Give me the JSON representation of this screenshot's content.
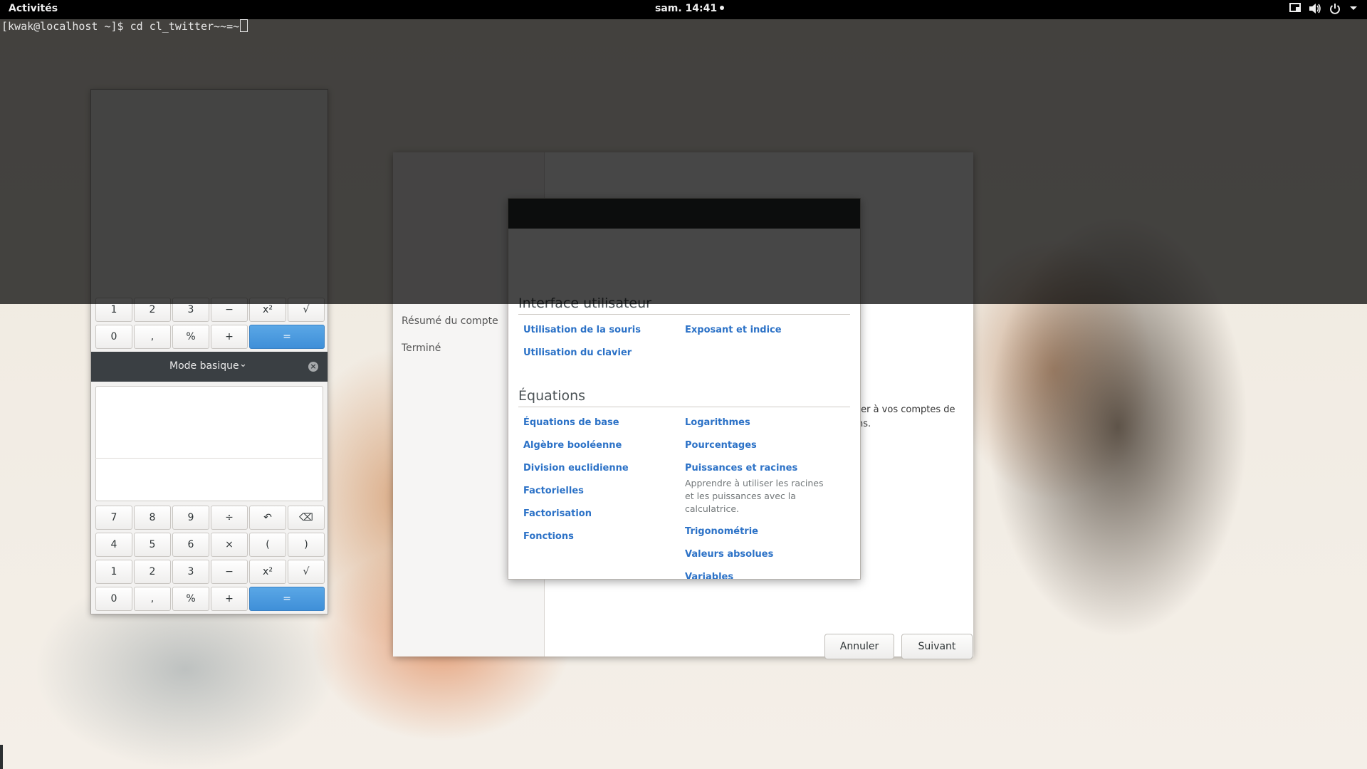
{
  "topbar": {
    "activities": "Activités",
    "clock": "sam. 14:41",
    "tray": [
      "screen-icon",
      "volume-icon",
      "power-icon",
      "menu-arrow-icon"
    ]
  },
  "terminal": {
    "prompt_line": "[kwak@localhost ~]$ cd cl_twitter~~=~"
  },
  "wizard": {
    "steps": [
      "Résumé du compte",
      "Terminé"
    ],
    "body_text": "ter à vos comptes de\nns.",
    "buttons": {
      "cancel": "Annuler",
      "next": "Suivant"
    }
  },
  "help": {
    "section1_title": "Interface utilisateur",
    "section1_links_left": [
      "Utilisation de la souris",
      "Utilisation du clavier"
    ],
    "section1_links_right": [
      "Exposant et indice"
    ],
    "section2_title": "Équations",
    "section2_links_left": [
      "Équations de base",
      "Algèbre booléenne",
      "Division euclidienne",
      "Factorielles",
      "Factorisation",
      "Fonctions"
    ],
    "section2_links_right": [
      "Logarithmes",
      "Pourcentages",
      "Puissances et racines",
      "Trigonométrie",
      "Valeurs absolues",
      "Variables"
    ],
    "powers_desc": "Apprendre à utiliser les racines et les puissances avec la calculatrice."
  },
  "calculator": {
    "mode": "Mode basique",
    "keys_row1": [
      "7",
      "8",
      "9",
      "÷",
      "↶",
      "⌫"
    ],
    "keys_row2": [
      "4",
      "5",
      "6",
      "×",
      "(",
      ")"
    ],
    "keys_row3": [
      "1",
      "2",
      "3",
      "−",
      "x²",
      "√"
    ],
    "keys_row4": [
      "0",
      ",",
      "%",
      "+",
      "="
    ],
    "upper_row3": [
      "1",
      "2",
      "3",
      "−",
      "x²",
      "√"
    ],
    "upper_row4": [
      "0",
      ",",
      "%",
      "+",
      "="
    ]
  },
  "colors": {
    "link": "#2c72c7",
    "equals_key": "#4a9be0",
    "topbar": "#000000"
  }
}
